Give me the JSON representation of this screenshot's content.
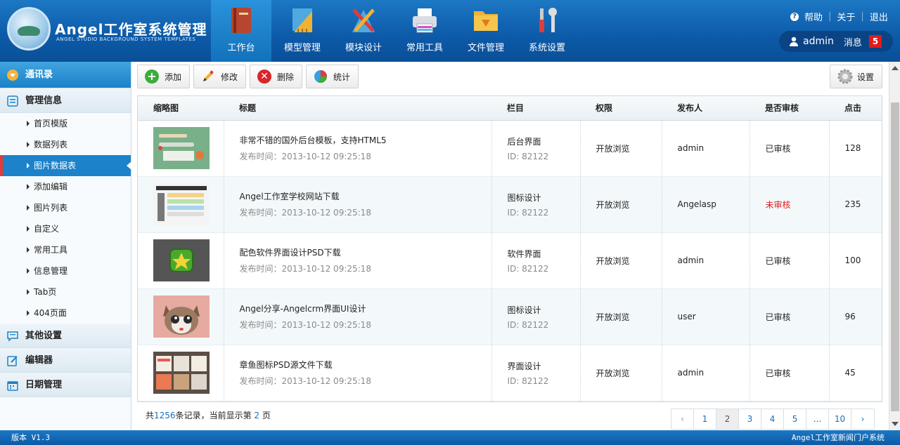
{
  "logo": {
    "title": "Angel工作室系统管理",
    "subtitle": "ANGEL STUDIO BACKGROUND SYSTEM TEMPLATES"
  },
  "nav": [
    {
      "label": "工作台",
      "icon": "book-icon"
    },
    {
      "label": "模型管理",
      "icon": "ruler-icon"
    },
    {
      "label": "模块设计",
      "icon": "design-tools-icon"
    },
    {
      "label": "常用工具",
      "icon": "printer-icon"
    },
    {
      "label": "文件管理",
      "icon": "folder-icon"
    },
    {
      "label": "系统设置",
      "icon": "wrench-icon"
    }
  ],
  "topright": {
    "help": "帮助",
    "about": "关于",
    "logout": "退出",
    "username": "admin",
    "messages": "消息",
    "msg_count": "5"
  },
  "sidebar": {
    "contacts": "通讯录",
    "manage": "管理信息",
    "items": [
      "首页模版",
      "数据列表",
      "图片数据表",
      "添加编辑",
      "图片列表",
      "自定义",
      "常用工具",
      "信息管理",
      "Tab页",
      "404页面"
    ],
    "other": "其他设置",
    "editor": "编辑器",
    "date": "日期管理"
  },
  "toolbar": {
    "add": "添加",
    "edit": "修改",
    "delete": "删除",
    "stats": "统计",
    "settings": "设置"
  },
  "table": {
    "headers": [
      "缩略图",
      "标题",
      "栏目",
      "权限",
      "发布人",
      "是否审核",
      "点击"
    ],
    "rows": [
      {
        "title": "非常不错的国外后台模板，支持HTML5",
        "time": "发布时间：2013-10-12 09:25:18",
        "column": "后台界面",
        "id": "ID: 82122",
        "perm": "开放浏览",
        "author": "admin",
        "status": "已审核",
        "clicks": "128"
      },
      {
        "title": "Angel工作室学校网站下载",
        "time": "发布时间：2013-10-12 09:25:18",
        "column": "图标设计",
        "id": "ID: 82122",
        "perm": "开放浏览",
        "author": "Angelasp",
        "status": "未审核",
        "clicks": "235"
      },
      {
        "title": "配色软件界面设计PSD下载",
        "time": "发布时间：2013-10-12 09:25:18",
        "column": "软件界面",
        "id": "ID: 82122",
        "perm": "开放浏览",
        "author": "admin",
        "status": "已审核",
        "clicks": "100"
      },
      {
        "title": "Angel分享-Angelcrm界面UI设计",
        "time": "发布时间：2013-10-12 09:25:18",
        "column": "图标设计",
        "id": "ID: 82122",
        "perm": "开放浏览",
        "author": "user",
        "status": "已审核",
        "clicks": "96"
      },
      {
        "title": "章鱼图标PSD源文件下载",
        "time": "发布时间：2013-10-12 09:25:18",
        "column": "界面设计",
        "id": "ID: 82122",
        "perm": "开放浏览",
        "author": "admin",
        "status": "已审核",
        "clicks": "45"
      }
    ]
  },
  "pager": {
    "prefix": "共",
    "total": "1256",
    "mid": "条记录，当前显示第 ",
    "current": "2",
    "suffix": " 页",
    "pages": [
      "1",
      "2",
      "3",
      "4",
      "5",
      "...",
      "10"
    ]
  },
  "footer": {
    "version": "版本 V1.3",
    "system": "Angel工作室新闻门户系统"
  }
}
